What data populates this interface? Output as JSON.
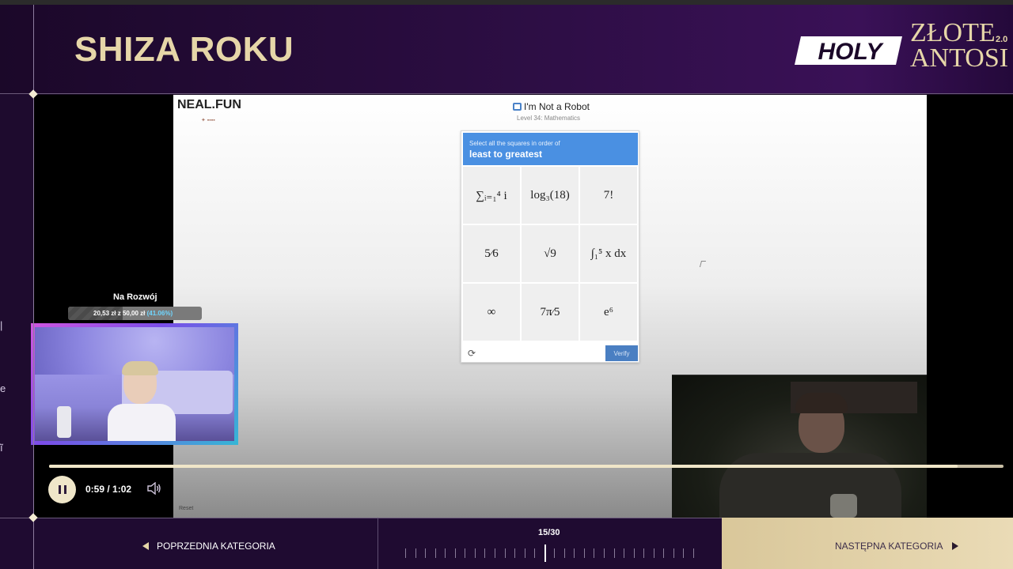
{
  "header": {
    "title": "SHIZA ROKU",
    "brand_holy": "HOLY",
    "brand_line1": "ZŁOTE",
    "brand_line2": "ANTOSI",
    "brand_year": "2.0"
  },
  "website": {
    "logo": "NEAL.FUN",
    "page_title": "I'm Not a Robot",
    "level": "Level 34: Mathematics",
    "captcha": {
      "instruction": "Select all the squares in order of",
      "emphasis": "least to greatest",
      "tiles": [
        {
          "label": "∑ᵢ₌₁⁴ i"
        },
        {
          "label": "log₃(18)"
        },
        {
          "label": "7!"
        },
        {
          "label": "5⁄6"
        },
        {
          "label": "√9"
        },
        {
          "label": "∫₁⁵ x dx"
        },
        {
          "label": "∞"
        },
        {
          "label": "7π⁄5"
        },
        {
          "label": "e⁶"
        }
      ],
      "verify_label": "Verify"
    },
    "reset_label": "Reset"
  },
  "donation": {
    "title": "Na Rozwój",
    "current": "20,53 zł",
    "separator": "z",
    "goal": "50,00 zł",
    "percent_text": "(41.06%)",
    "percent": 41.06
  },
  "player": {
    "time_text": "0:59 / 1:02",
    "progress": 0.952
  },
  "footer": {
    "prev_label": "POPRZEDNIA KATEGORIA",
    "next_label": "NASTĘPNA KATEGORIA",
    "counter": "15/30",
    "current_index": 15,
    "total": 30
  },
  "colors": {
    "gold": "#e6d6a8",
    "captcha_blue": "#4a90e2",
    "purple_bg": "#2a0d40"
  }
}
